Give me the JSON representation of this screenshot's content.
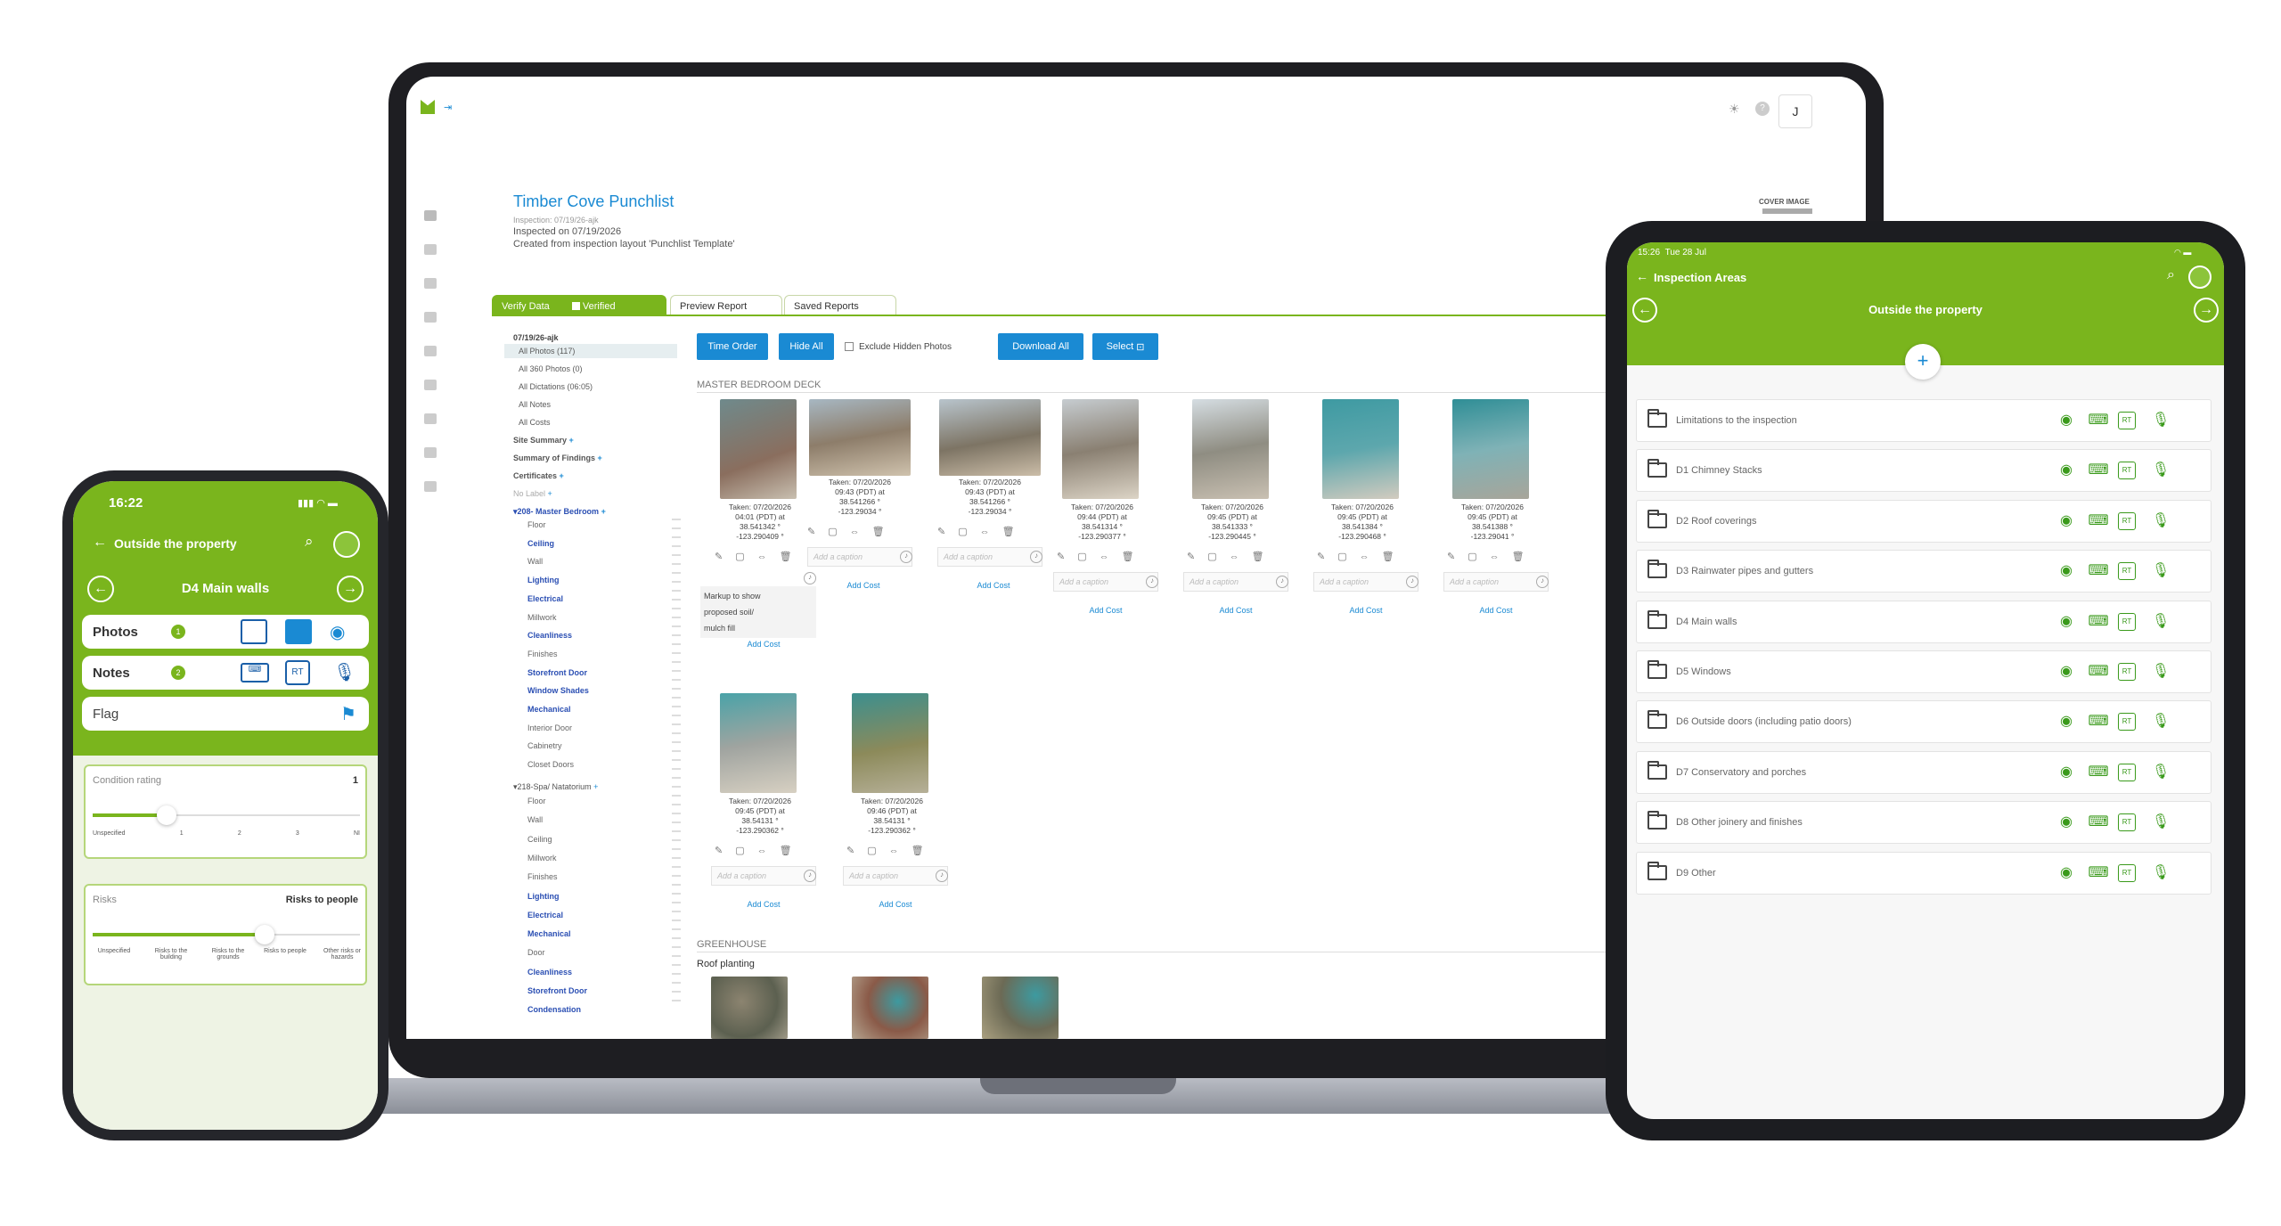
{
  "laptop": {
    "title": "Timber Cove Punchlist",
    "inspection_id": "Inspection: 07/19/26-ajk",
    "inspected_on": "Inspected on 07/19/2026",
    "created_from": "Created from inspection layout 'Punchlist Template'",
    "cover_image": "COVER IMAGE",
    "avatar": "J",
    "tabs": {
      "verify_data": "Verify Data",
      "verified": "Verified",
      "preview_report": "Preview Report",
      "saved_reports": "Saved Reports"
    },
    "toolbar": {
      "time_order": "Time Order",
      "hide_all": "Hide All",
      "exclude_hidden": "Exclude Hidden Photos",
      "download_all": "Download All",
      "select": "Select"
    },
    "tree": {
      "root": "07/19/26-ajk",
      "items": [
        "All Photos (117)",
        "All 360 Photos (0)",
        "All Dictations (06:05)",
        "All Notes",
        "All Costs"
      ],
      "site_summary": "Site Summary",
      "summary_findings": "Summary of Findings",
      "certificates": "Certificates",
      "no_label": "No Label",
      "room1": "208- Master Bedroom",
      "room1_items": [
        "Floor",
        "Ceiling",
        "Wall",
        "Lighting",
        "Electrical",
        "Millwork",
        "Cleanliness",
        "Finishes",
        "Storefront Door",
        "Window Shades",
        "Mechanical",
        "Interior Door",
        "Cabinetry",
        "Closet Doors"
      ],
      "room2": "218-Spa/ Natatorium",
      "room2_items": [
        "Floor",
        "Wall",
        "Ceiling",
        "Millwork",
        "Finishes",
        "Lighting",
        "Electrical",
        "Mechanical",
        "Door",
        "Cleanliness",
        "Storefront Door",
        "Condensation"
      ]
    },
    "section1": "MASTER BEDROOM DECK",
    "section2": "GREENHOUSE",
    "subsection2": "Roof planting",
    "photos": [
      {
        "taken": "Taken: 07/20/2026",
        "time": "04:01 (PDT) at",
        "lat": "38.541342 °",
        "lon": "-123.290409 °"
      },
      {
        "taken": "Taken: 07/20/2026",
        "time": "09:43 (PDT) at",
        "lat": "38.541266 °",
        "lon": "-123.29034 °"
      },
      {
        "taken": "Taken: 07/20/2026",
        "time": "09:43 (PDT) at",
        "lat": "38.541266 °",
        "lon": "-123.29034 °"
      },
      {
        "taken": "Taken: 07/20/2026",
        "time": "09:44 (PDT) at",
        "lat": "38.541314 °",
        "lon": "-123.290377 °"
      },
      {
        "taken": "Taken: 07/20/2026",
        "time": "09:45 (PDT) at",
        "lat": "38.541333 °",
        "lon": "-123.290445 °"
      },
      {
        "taken": "Taken: 07/20/2026",
        "time": "09:45 (PDT) at",
        "lat": "38.541384 °",
        "lon": "-123.290468 °"
      },
      {
        "taken": "Taken: 07/20/2026",
        "time": "09:45 (PDT) at",
        "lat": "38.541388 °",
        "lon": "-123.29041 °"
      },
      {
        "taken": "Taken: 07/20/2026",
        "time": "09:45 (PDT) at",
        "lat": "38.54131 °",
        "lon": "-123.290362 °"
      },
      {
        "taken": "Taken: 07/20/2026",
        "time": "09:46 (PDT) at",
        "lat": "38.54131 °",
        "lon": "-123.290362 °"
      }
    ],
    "note1": [
      "Markup to show",
      "proposed soil/",
      "mulch fill"
    ],
    "caption_placeholder": "Add a caption",
    "add_cost": "Add Cost"
  },
  "phone": {
    "time": "16:22",
    "back_title": "Outside the property",
    "section": "D4 Main walls",
    "photos_label": "Photos",
    "photos_count": "1",
    "notes_label": "Notes",
    "notes_count": "2",
    "flag_label": "Flag",
    "condition_label": "Condition rating",
    "condition_value": "1",
    "condition_ticks": [
      "Unspecified",
      "1",
      "2",
      "3",
      "NI"
    ],
    "risks_label": "Risks",
    "risks_value": "Risks to people",
    "risks_ticks": [
      "Unspecified",
      "Risks to the building",
      "Risks to the grounds",
      "Risks to people",
      "Other risks or hazards"
    ],
    "rt": "RT"
  },
  "tablet": {
    "time": "15:26",
    "date": "Tue 28 Jul",
    "title": "Inspection Areas",
    "subtitle": "Outside the property",
    "rt": "RT",
    "rows": [
      "Limitations to the inspection",
      "D1 Chimney Stacks",
      "D2 Roof coverings",
      "D3 Rainwater pipes and gutters",
      "D4 Main walls",
      "D5 Windows",
      "D6 Outside doors (including patio doors)",
      "D7 Conservatory and porches",
      "D8 Other joinery and finishes",
      "D9 Other"
    ]
  }
}
